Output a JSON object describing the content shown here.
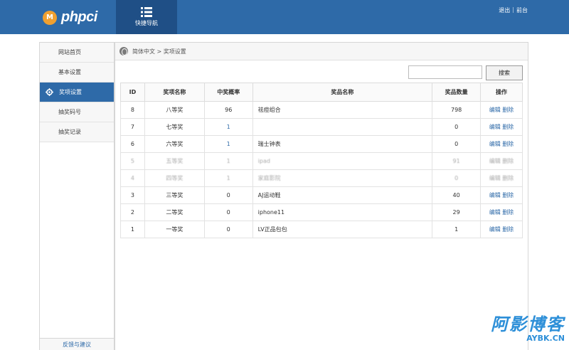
{
  "header": {
    "logo_badge": "M",
    "logo_text": "phpci",
    "quicknav_label": "快捷导航",
    "link_logout": "退出",
    "link_separator": "|",
    "link_home": "前台"
  },
  "sidebar": {
    "items": [
      {
        "label": "网站首页"
      },
      {
        "label": "基本设置"
      },
      {
        "label": "奖项设置"
      },
      {
        "label": "抽奖码号"
      },
      {
        "label": "抽奖记录"
      }
    ],
    "bottom_label": "反馈与建议"
  },
  "breadcrumb": {
    "text": "简体中文 > 奖项设置"
  },
  "search": {
    "placeholder": "",
    "button_label": "搜索"
  },
  "table": {
    "headers": [
      "ID",
      "奖项名称",
      "中奖概率",
      "奖品名称",
      "奖品数量",
      "操作"
    ],
    "rows": [
      {
        "id": "8",
        "award": "八等奖",
        "prob": "96",
        "prize": "祛痘组合",
        "qty": "798",
        "edit": "编辑",
        "del": "删除"
      },
      {
        "id": "7",
        "award": "七等奖",
        "prob": "1",
        "prize": "",
        "qty": "0",
        "edit": "编辑",
        "del": "删除"
      },
      {
        "id": "6",
        "award": "六等奖",
        "prob": "1",
        "prize": "瑞士钟表",
        "qty": "0",
        "edit": "编辑",
        "del": "删除"
      },
      {
        "id": "5",
        "award": "五等奖",
        "prob": "1",
        "prize": "ipad",
        "qty": "91",
        "edit": "编辑",
        "del": "删除"
      },
      {
        "id": "4",
        "award": "四等奖",
        "prob": "1",
        "prize": "家庭影院",
        "qty": "0",
        "edit": "编辑",
        "del": "删除"
      },
      {
        "id": "3",
        "award": "三等奖",
        "prob": "0",
        "prize": "AJ运动鞋",
        "qty": "40",
        "edit": "编辑",
        "del": "删除"
      },
      {
        "id": "2",
        "award": "二等奖",
        "prob": "0",
        "prize": "iphone11",
        "qty": "29",
        "edit": "编辑",
        "del": "删除"
      },
      {
        "id": "1",
        "award": "一等奖",
        "prob": "0",
        "prize": "LV正品包包",
        "qty": "1",
        "edit": "编辑",
        "del": "删除"
      }
    ]
  },
  "watermark": {
    "title": "阿影博客",
    "subtitle": "AYBK.CN"
  },
  "colors": {
    "topbar": "#2e6aa8",
    "quicknav": "#1f4f86",
    "link": "#2e6aa8",
    "logo_badge": "#f0a030"
  }
}
